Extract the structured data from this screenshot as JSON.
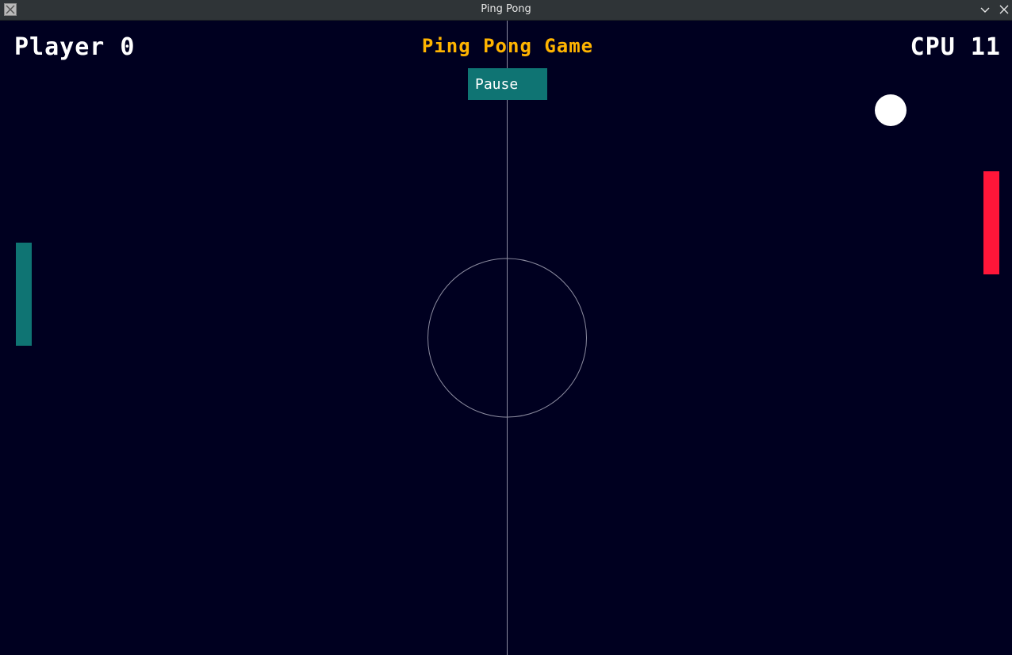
{
  "window": {
    "title": "Ping Pong",
    "icons": [
      "app-icon",
      "chevron-down-icon",
      "close-icon"
    ]
  },
  "game": {
    "title": "Ping Pong Game",
    "player_score_text": "Player 0",
    "cpu_score_text": "CPU 11",
    "pause_label": "Pause"
  },
  "colors": {
    "background": "#000020",
    "title": "#ffb400",
    "player_paddle": "#0f7473",
    "cpu_paddle": "#ff1639",
    "pause_button": "#0f7473",
    "ball": "#ffffff",
    "court_lines": "#8c8ca0"
  }
}
